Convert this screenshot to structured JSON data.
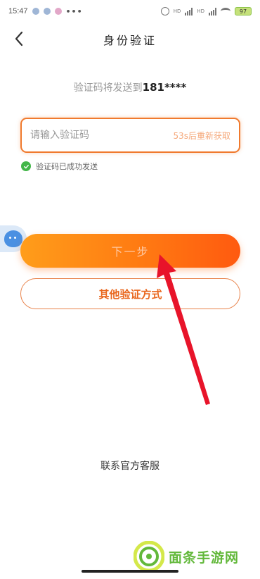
{
  "status_bar": {
    "time": "15:47",
    "more": "•••",
    "hd1": "HD",
    "hd2": "HD",
    "battery": "97"
  },
  "header": {
    "title": "身份验证",
    "back_icon": "chevron-left-icon"
  },
  "verification": {
    "sent_prefix": "验证码将发送到",
    "phone": "181****",
    "input_placeholder": "请输入验证码",
    "input_value": "",
    "resend_label": "53s后重新获取",
    "success_text": "验证码已成功发送"
  },
  "buttons": {
    "next_label": "下一步",
    "other_methods_label": "其他验证方式"
  },
  "footer": {
    "service_label": "联系官方客服"
  },
  "watermark": {
    "text": "面条手游网"
  },
  "colors": {
    "accent": "#f07a2e",
    "button_start": "#ff9d1a",
    "button_end": "#ff5a10",
    "success": "#43b649",
    "arrow": "#e8142a",
    "watermark": "#62b83a"
  }
}
